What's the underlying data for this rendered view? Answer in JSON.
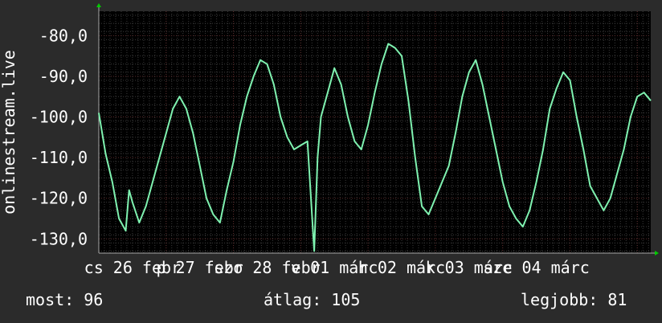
{
  "colors": {
    "background": "#2b2b2b",
    "plot_background": "#000000",
    "line": "#7ff2b0",
    "grid_major": "#5a2a2a",
    "grid_minor": "#3a3a3a",
    "axis_arrow": "#00cc00",
    "text": "#ffffff"
  },
  "stats": {
    "now": "most: 96",
    "avg": "átlag: 105",
    "best": "legjobb: 81"
  },
  "chart_data": {
    "type": "line",
    "title": "",
    "ylabel": "onlinestream.live",
    "xlabel": "",
    "ylim": [
      -133.5,
      -74
    ],
    "xlim": [
      0,
      8.2
    ],
    "yticks": [
      -80,
      -90,
      -100,
      -110,
      -120,
      -130
    ],
    "ytick_labels": [
      "-80,0",
      "-90,0",
      "-100,0",
      "-110,0",
      "-120,0",
      "-130,0"
    ],
    "xtick_labels": [
      "cs 26 febr",
      "p 27 febr",
      "szo 28 febr",
      "v 01 márc",
      "h 02 márc",
      "k 03 márc",
      "sze 04 márc"
    ],
    "xtick_positions": [
      0.5,
      1.5,
      2.5,
      3.5,
      4.5,
      5.5,
      6.5
    ],
    "grid": true,
    "legend": "none",
    "series": [
      {
        "x": [
          0.0,
          0.1,
          0.2,
          0.3,
          0.4,
          0.45,
          0.5,
          0.6,
          0.7,
          0.8,
          0.9,
          1.0,
          1.1,
          1.2,
          1.3,
          1.4,
          1.5,
          1.6,
          1.7,
          1.8,
          1.9,
          2.0,
          2.1,
          2.2,
          2.3,
          2.4,
          2.5,
          2.6,
          2.7,
          2.8,
          2.9,
          3.0,
          3.1,
          3.2,
          3.25,
          3.3,
          3.4,
          3.5,
          3.6,
          3.7,
          3.8,
          3.9,
          4.0,
          4.1,
          4.2,
          4.3,
          4.4,
          4.5,
          4.6,
          4.7,
          4.8,
          4.9,
          5.0,
          5.1,
          5.2,
          5.3,
          5.4,
          5.5,
          5.6,
          5.7,
          5.8,
          5.9,
          6.0,
          6.1,
          6.2,
          6.3,
          6.4,
          6.5,
          6.6,
          6.7,
          6.8,
          6.9,
          7.0,
          7.1,
          7.2,
          7.3,
          7.4,
          7.5,
          7.6,
          7.7,
          7.8,
          7.9,
          8.0,
          8.1,
          8.2
        ],
        "y": [
          -99,
          -109,
          -116,
          -125,
          -128,
          -118,
          -121,
          -126,
          -122,
          -116,
          -110,
          -104,
          -98,
          -95,
          -98,
          -104,
          -112,
          -120,
          -124,
          -126,
          -118,
          -111,
          -102,
          -95,
          -90,
          -86,
          -87,
          -92,
          -100,
          -105,
          -108,
          -107,
          -106,
          -133,
          -110,
          -100,
          -94,
          -88,
          -92,
          -100,
          -106,
          -108,
          -102,
          -94,
          -87,
          -82,
          -83,
          -85,
          -96,
          -110,
          -122,
          -124,
          -120,
          -116,
          -112,
          -104,
          -95,
          -89,
          -86,
          -92,
          -100,
          -108,
          -116,
          -122,
          -125,
          -127,
          -123,
          -116,
          -108,
          -98,
          -93,
          -89,
          -91,
          -100,
          -108,
          -117,
          -120,
          -123,
          -120,
          -114,
          -108,
          -100,
          -95,
          -94,
          -96
        ]
      }
    ]
  }
}
